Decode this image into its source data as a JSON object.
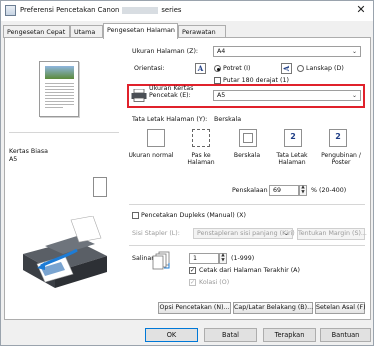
{
  "window": {
    "title_prefix": "Preferensi Pencetakan Canon",
    "title_suffix": "series",
    "close_glyph": "✕"
  },
  "tabs": [
    {
      "label": "Pengesetan Cepat"
    },
    {
      "label": "Utama"
    },
    {
      "label": "Pengesetan Halaman"
    },
    {
      "label": "Perawatan"
    }
  ],
  "left": {
    "media_type": "Kertas Biasa",
    "paper_size": "A5"
  },
  "page_setup": {
    "page_size_label": "Ukuran Halaman (Z):",
    "page_size_value": "A4",
    "orientation_label": "Orientasi:",
    "portrait_label": "Potret (I)",
    "landscape_label": "Lanskap (D)",
    "rotate_label": "Putar 180 derajat (1)",
    "printer_paper_label_1": "Ukuran Kertas",
    "printer_paper_label_2": "Pencetak (E):",
    "printer_paper_value": "A5",
    "print_layout_label": "Tata Letak Halaman (Y):",
    "print_layout_value": "Berskala",
    "layout_options": [
      {
        "label": "Ukuran normal",
        "icon": "normal-size-icon"
      },
      {
        "label": "Pas ke Halaman",
        "icon": "fit-to-page-icon"
      },
      {
        "label": "Berskala",
        "icon": "scaled-icon"
      },
      {
        "label": "Tata Letak Halaman",
        "icon": "page-layout-icon",
        "num": "2"
      },
      {
        "label": "Pengubinan / Poster",
        "icon": "tiling-poster-icon",
        "num": "2"
      }
    ],
    "scaling_label": "Penskalaan (S):",
    "scaling_value": "69",
    "scaling_range": "% (20-400)",
    "duplex_label": "Pencetakan Dupleks (Manual) (X)",
    "stapling_side_label": "Sisi Stapler (L):",
    "stapling_side_value": "Penstapleran sisi panjang (Kiri)",
    "margin_button": "Tentukan Margin (S)...",
    "copies_label": "Salinan (C):",
    "copies_value": "1",
    "copies_range": "(1-999)",
    "last_page_first_label": "Cetak dari Halaman Terakhir (A)",
    "collate_label": "Kolasi (O)",
    "print_options_button": "Opsi Pencetakan (N)...",
    "stamp_background_button": "Cap/Latar Belakang (B)...",
    "defaults_button": "Setelan Asal (F)"
  },
  "footer": {
    "ok": "OK",
    "cancel": "Batal",
    "apply": "Terapkan",
    "help": "Bantuan"
  }
}
